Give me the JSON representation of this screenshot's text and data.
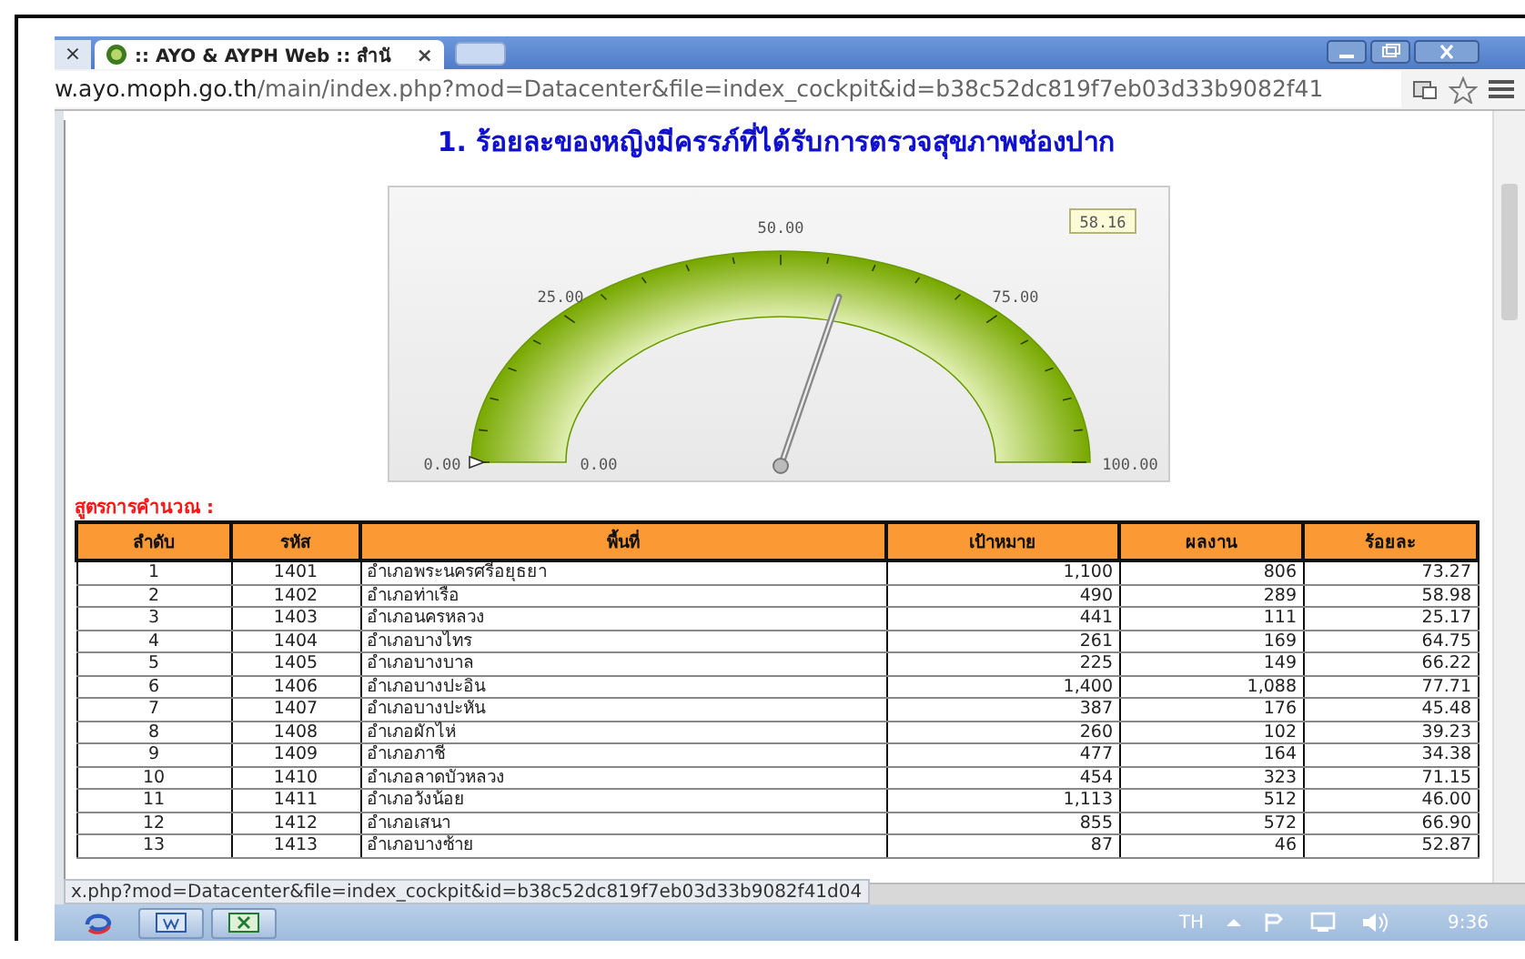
{
  "browser": {
    "prev_tab_close": "×",
    "tab": {
      "title": ":: AYO & AYPH Web :: สำนั",
      "close": "×"
    },
    "url_host": "w.ayo.moph.go.th",
    "url_path": "/main/index.php?mod=Datacenter&file=index_cockpit&id=b38c52dc819f7eb03d33b9082f41",
    "status_url": "x.php?mod=Datacenter&file=index_cockpit&id=b38c52dc819f7eb03d33b9082f41d04"
  },
  "page": {
    "title": "1. ร้อยละของหญิงมีครรภ์ที่ได้รับการตรวจสุขภาพช่องปาก",
    "gauge": {
      "level": 0.5816,
      "value_label": "58.16",
      "min_label": "0.00",
      "start_label": "0.00",
      "tick_labels": [
        "25.00",
        "50.00",
        "75.00"
      ],
      "max_label": "100.00"
    },
    "formula_label": "สูตรการคำนวณ :",
    "table": {
      "columns": [
        "ลำดับ",
        "รหัส",
        "พื้นที่",
        "เป้าหมาย",
        "ผลงาน",
        "ร้อยละ"
      ],
      "rows": [
        [
          "1",
          "1401",
          "อำเภอพระนครศรีอยุธยา",
          "1,100",
          "806",
          "73.27"
        ],
        [
          "2",
          "1402",
          "อำเภอท่าเรือ",
          "490",
          "289",
          "58.98"
        ],
        [
          "3",
          "1403",
          "อำเภอนครหลวง",
          "441",
          "111",
          "25.17"
        ],
        [
          "4",
          "1404",
          "อำเภอบางไทร",
          "261",
          "169",
          "64.75"
        ],
        [
          "5",
          "1405",
          "อำเภอบางบาล",
          "225",
          "149",
          "66.22"
        ],
        [
          "6",
          "1406",
          "อำเภอบางปะอิน",
          "1,400",
          "1,088",
          "77.71"
        ],
        [
          "7",
          "1407",
          "อำเภอบางปะหัน",
          "387",
          "176",
          "45.48"
        ],
        [
          "8",
          "1408",
          "อำเภอผักไห่",
          "260",
          "102",
          "39.23"
        ],
        [
          "9",
          "1409",
          "อำเภอภาชี",
          "477",
          "164",
          "34.38"
        ],
        [
          "10",
          "1410",
          "อำเภอลาดบัวหลวง",
          "454",
          "323",
          "71.15"
        ],
        [
          "11",
          "1411",
          "อำเภอวังน้อย",
          "1,113",
          "512",
          "46.00"
        ],
        [
          "12",
          "1412",
          "อำเภอเสนา",
          "855",
          "572",
          "66.90"
        ],
        [
          "13",
          "1413",
          "อำเภอบางซ้าย",
          "87",
          "46",
          "52.87"
        ]
      ]
    }
  },
  "taskbar": {
    "language": "TH",
    "clock": "9:36"
  }
}
